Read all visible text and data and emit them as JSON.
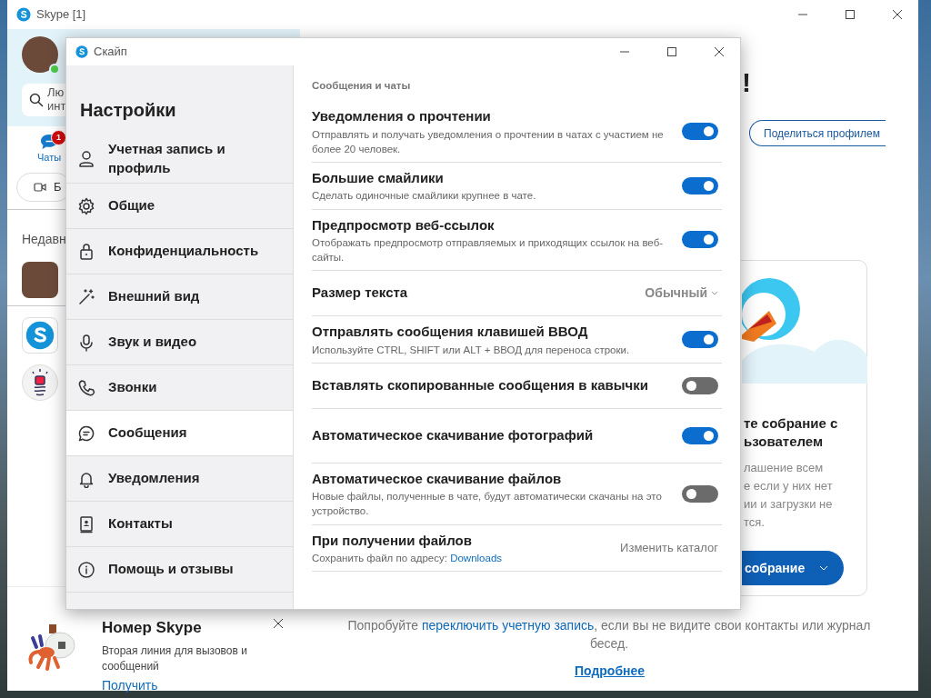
{
  "main_window": {
    "title": "Skype [1]",
    "search_placeholder_lines": [
      "Лю",
      "инт"
    ],
    "chats_tab": {
      "label": "Чаты",
      "badge": "1",
      "selected": true
    },
    "call_button_fragment": "Б",
    "recent_fragment": "Недавн",
    "heading_fragment": "!",
    "share_button": "Поделиться профилем",
    "card": {
      "title_lines": [
        "те собрание с",
        "ьзователем"
      ],
      "text_lines": [
        "лашение всем",
        "е если у них нет",
        "ии и загрузки не",
        "тся."
      ],
      "button": "собрание"
    },
    "hint_link": "переключить учетную запись",
    "hint_before": "Попробуйте ",
    "hint_after": ", если вы не видите свои контакты или журнал бесед.",
    "more_link": "Подробнее",
    "promo": {
      "title": "Номер Skype",
      "text": "Вторая линия для вызовов и сообщений",
      "action": "Получить"
    }
  },
  "settings_window": {
    "title": "Скайп",
    "heading": "Настройки",
    "sidebar": [
      {
        "label": "Учетная запись и профиль",
        "kind": "person",
        "selected": false
      },
      {
        "label": "Общие",
        "kind": "gear",
        "selected": false
      },
      {
        "label": "Конфиденциальность",
        "kind": "lock",
        "selected": false
      },
      {
        "label": "Внешний вид",
        "kind": "wand",
        "selected": false
      },
      {
        "label": "Звук и видео",
        "kind": "mic",
        "selected": false
      },
      {
        "label": "Звонки",
        "kind": "phone",
        "selected": false
      },
      {
        "label": "Сообщения",
        "kind": "chat",
        "selected": true
      },
      {
        "label": "Уведомления",
        "kind": "bell",
        "selected": false
      },
      {
        "label": "Контакты",
        "kind": "contacts",
        "selected": false
      },
      {
        "label": "Помощь и отзывы",
        "kind": "info",
        "selected": false
      }
    ],
    "section": "Сообщения и чаты",
    "items": [
      {
        "kind": "toggle",
        "title": "Уведомления о прочтении",
        "description": "Отправлять и получать уведомления о прочтении в чатах с участием не более 20 человек.",
        "on": true
      },
      {
        "kind": "toggle",
        "title": "Большие смайлики",
        "description": "Сделать одиночные смайлики крупнее в чате.",
        "on": true
      },
      {
        "kind": "toggle",
        "title": "Предпросмотр веб-ссылок",
        "description": "Отображать предпросмотр отправляемых и приходящих ссылок на веб-сайты.",
        "on": true
      },
      {
        "kind": "select",
        "title": "Размер текста",
        "value": "Обычный"
      },
      {
        "kind": "toggle",
        "title": "Отправлять сообщения клавишей ВВОД",
        "description": "Используйте CTRL, SHIFT или ALT + ВВОД для переноса строки.",
        "on": true
      },
      {
        "kind": "toggle",
        "title": "Вставлять скопированные сообщения в кавычки",
        "on": false
      },
      {
        "kind": "toggle",
        "title": "Автоматическое скачивание фотографий",
        "on": true
      },
      {
        "kind": "toggle",
        "title": "Автоматическое скачивание файлов",
        "description": "Новые файлы, полученные в чате, будут автоматически скачаны на это устройство.",
        "on": false
      },
      {
        "kind": "folder",
        "title": "При получении файлов",
        "description": "Сохранить файл по адресу:",
        "link": "Downloads",
        "action": "Изменить каталог"
      }
    ]
  }
}
